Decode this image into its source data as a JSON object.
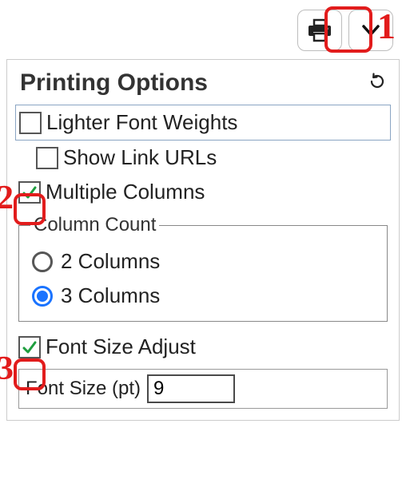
{
  "panel": {
    "title": "Printing Options"
  },
  "options": {
    "lighter_font_weights": {
      "label": "Lighter Font Weights",
      "checked": false
    },
    "show_link_urls": {
      "label": "Show Link URLs",
      "checked": false
    },
    "multiple_columns": {
      "label": "Multiple Columns",
      "checked": true
    },
    "font_size_adjust": {
      "label": "Font Size Adjust",
      "checked": true
    }
  },
  "column_count": {
    "legend": "Column Count",
    "options": [
      {
        "label": "2 Columns",
        "value": 2
      },
      {
        "label": "3 Columns",
        "value": 3
      }
    ],
    "selected": 3
  },
  "font_size": {
    "label": "Font Size (pt)",
    "value": "9"
  },
  "annotations": {
    "n1": "1",
    "n2": "2",
    "n3": "3"
  }
}
